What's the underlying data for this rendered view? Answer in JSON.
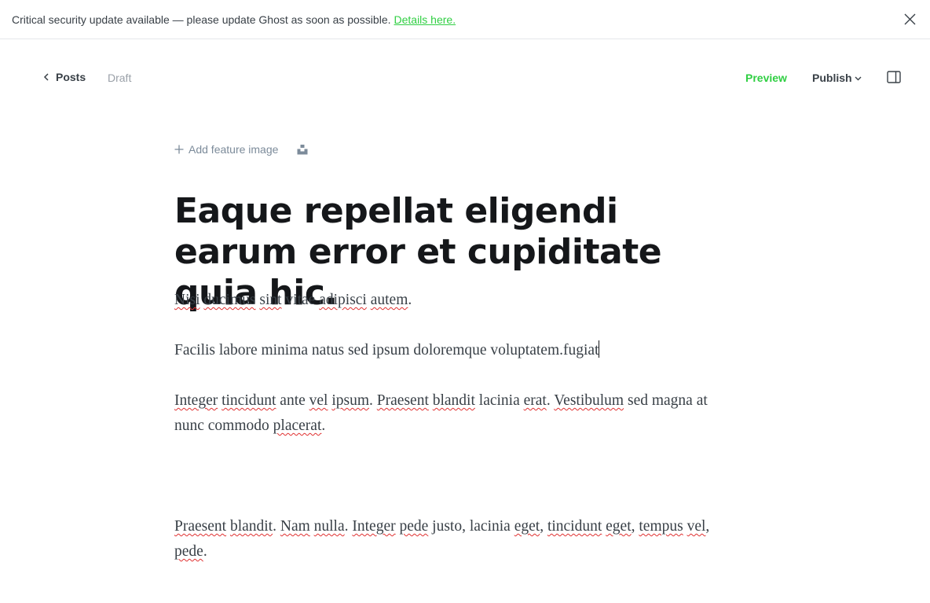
{
  "alert": {
    "message": "Critical security update available — please update Ghost as soon as possible.",
    "link_text": "Details here."
  },
  "header": {
    "back_label": "Posts",
    "status": "Draft",
    "preview_label": "Preview",
    "publish_label": "Publish"
  },
  "feature": {
    "add_label": "Add feature image"
  },
  "post": {
    "title": "Eaque repellat eligendi earum error et cupiditate quia hic.",
    "paragraphs": [
      {
        "parts": [
          {
            "t": "Nisi",
            "spell": true
          },
          {
            "t": " "
          },
          {
            "t": "ducimus",
            "spell": true
          },
          {
            "t": " "
          },
          {
            "t": "sint",
            "spell": true
          },
          {
            "t": " vitae "
          },
          {
            "t": "adipisci",
            "spell": true
          },
          {
            "t": " "
          },
          {
            "t": "autem",
            "spell": true
          },
          {
            "t": "."
          }
        ]
      },
      {
        "parts": [
          {
            "t": "Facilis labore minima natus sed ipsum doloremque voluptatem.fugiat"
          }
        ],
        "caret": true
      },
      {
        "parts": [
          {
            "t": "Integer",
            "spell": true
          },
          {
            "t": " "
          },
          {
            "t": "tincidunt",
            "spell": true
          },
          {
            "t": " ante "
          },
          {
            "t": "vel",
            "spell": true
          },
          {
            "t": " "
          },
          {
            "t": "ipsum",
            "spell": true
          },
          {
            "t": ". "
          },
          {
            "t": "Praesent",
            "spell": true
          },
          {
            "t": " "
          },
          {
            "t": "blandit",
            "spell": true
          },
          {
            "t": " lacinia "
          },
          {
            "t": "erat",
            "spell": true
          },
          {
            "t": ". "
          },
          {
            "t": "Vestibulum",
            "spell": true
          },
          {
            "t": " sed magna at nunc commodo "
          },
          {
            "t": "placerat",
            "spell": true
          },
          {
            "t": "."
          }
        ]
      },
      {
        "parts": [
          {
            "t": "Praesent",
            "spell": true
          },
          {
            "t": " "
          },
          {
            "t": "blandit",
            "spell": true
          },
          {
            "t": ". "
          },
          {
            "t": "Nam",
            "spell": true
          },
          {
            "t": " "
          },
          {
            "t": "nulla",
            "spell": true
          },
          {
            "t": ". "
          },
          {
            "t": "Integer",
            "spell": true
          },
          {
            "t": " "
          },
          {
            "t": "pede",
            "spell": true
          },
          {
            "t": " justo, lacinia "
          },
          {
            "t": "eget",
            "spell": true
          },
          {
            "t": ", "
          },
          {
            "t": "tincidunt",
            "spell": true
          },
          {
            "t": " "
          },
          {
            "t": "eget",
            "spell": true
          },
          {
            "t": ", "
          },
          {
            "t": "tempus",
            "spell": true
          },
          {
            "t": " "
          },
          {
            "t": "vel",
            "spell": true
          },
          {
            "t": ", "
          },
          {
            "t": "pede",
            "spell": true
          },
          {
            "t": "."
          }
        ]
      }
    ]
  },
  "colors": {
    "accent": "#30cf43",
    "text": "#15171a",
    "muted": "#9aa0a8",
    "spellcheck": "#e03131"
  },
  "icons": [
    "close-icon",
    "chevron-left-icon",
    "chevron-down-icon",
    "sidebar-toggle-icon",
    "plus-icon",
    "unsplash-icon"
  ]
}
